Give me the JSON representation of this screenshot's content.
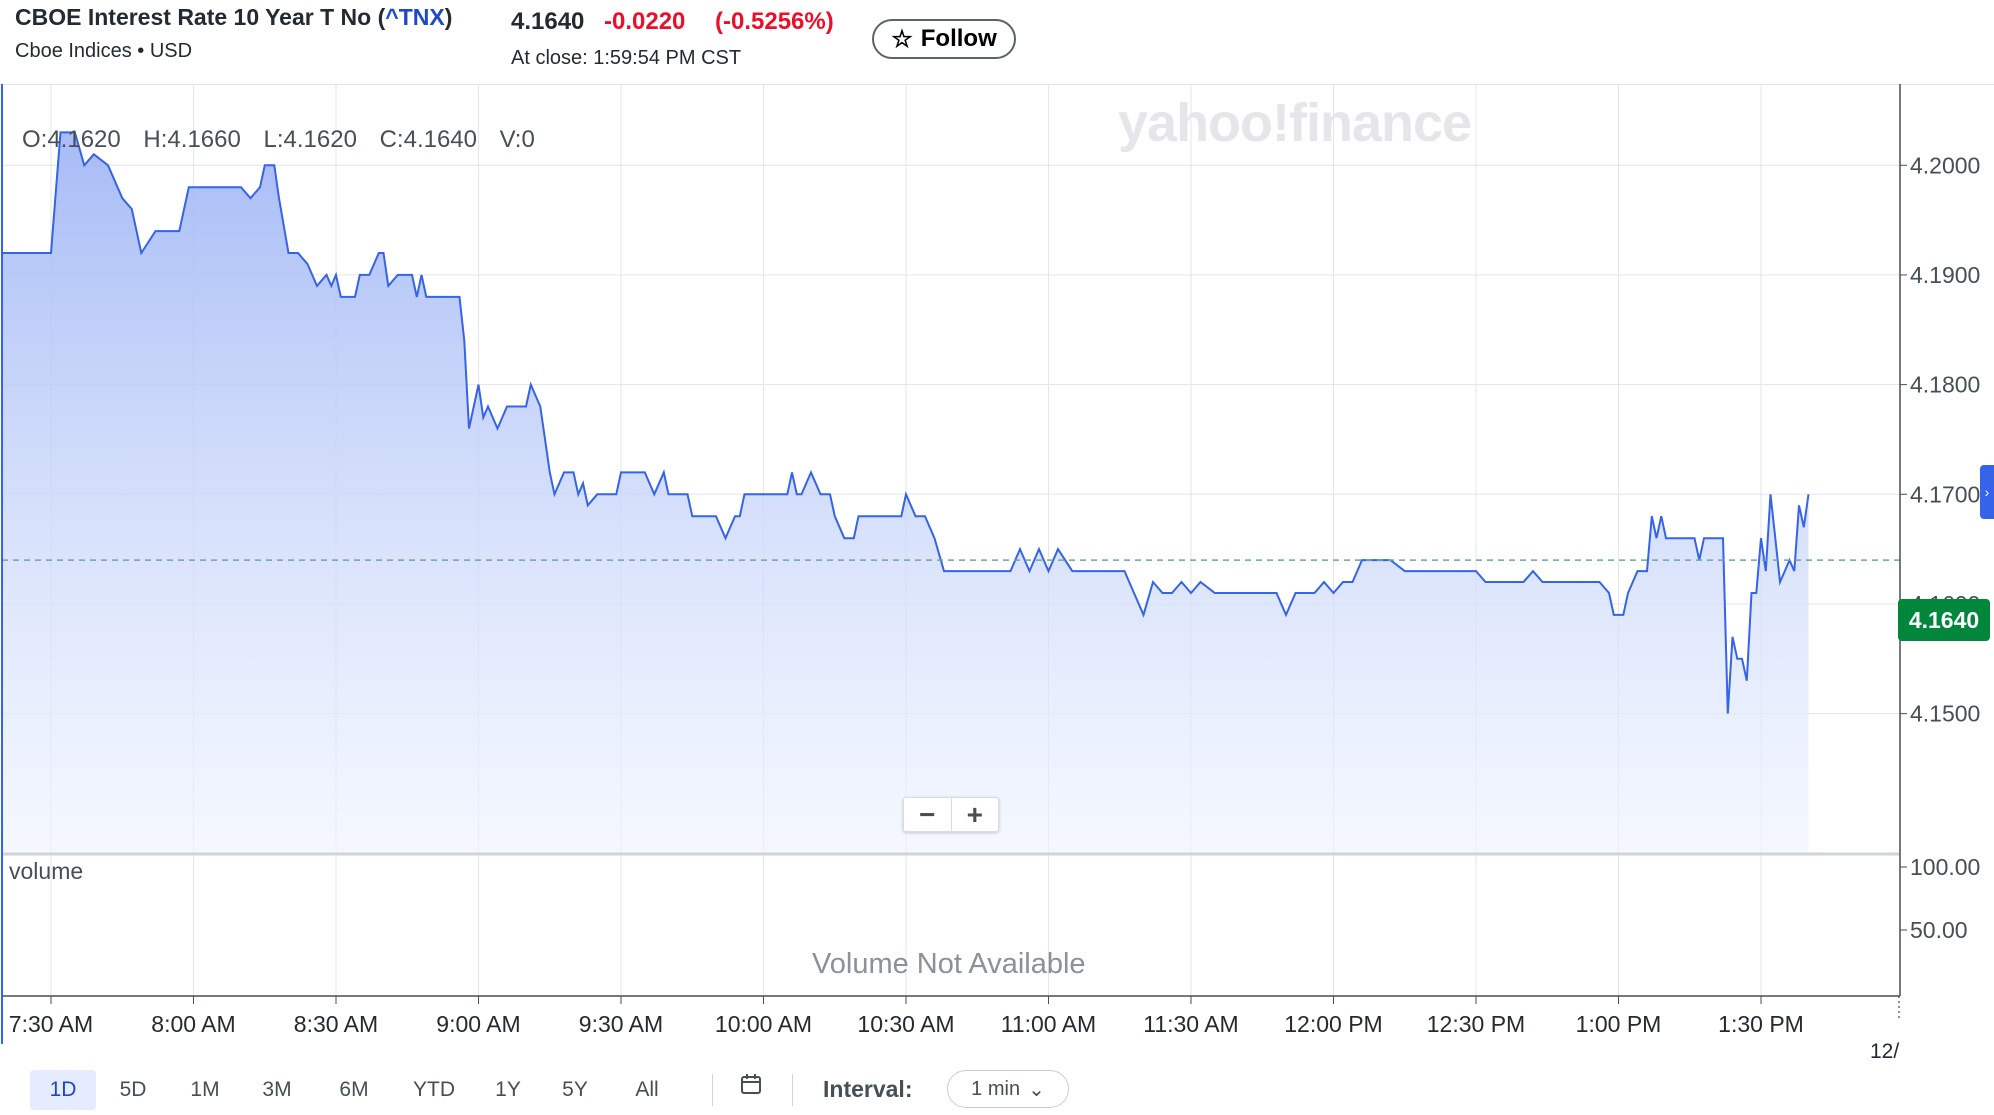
{
  "quote": {
    "name": "CBOE Interest Rate 10 Year T No",
    "symbol_open": "(",
    "symbol": "^TNX",
    "symbol_close": ")",
    "exchange": "Cboe Indices • USD",
    "price": "4.1640",
    "change": "-0.0220",
    "change_pct": "(-0.5256%)",
    "close_time": "At close: 1:59:54 PM CST",
    "follow_label": "Follow"
  },
  "ohlc": {
    "o": "O:4.1620",
    "h": "H:4.1660",
    "l": "L:4.1620",
    "c": "C:4.1640",
    "v": "V:0"
  },
  "watermark": "yahoo!finance",
  "volume": {
    "label": "volume",
    "not_available": "Volume Not Available",
    "ticks": [
      "100.00",
      "50.00"
    ]
  },
  "zoom": {
    "minus": "−",
    "plus": "+"
  },
  "current_price_badge": "4.1640",
  "date_tick": "12/",
  "ranges": [
    "1D",
    "5D",
    "1M",
    "3M",
    "6M",
    "YTD",
    "1Y",
    "5Y",
    "All"
  ],
  "active_range": "1D",
  "interval": {
    "label": "Interval:",
    "value": "1 min"
  },
  "colors": {
    "line": "#3563e9",
    "up": "#00873c",
    "down": "#eb0f29",
    "symbol": "#1d49c9"
  },
  "icons": {
    "follow": "star-outline-icon",
    "calendar": "calendar-icon",
    "dropdown": "chevron-down-icon",
    "side": "chevron-right-icon"
  },
  "chart_data": {
    "type": "area",
    "title": "",
    "xlabel": "",
    "ylabel": "",
    "x_ticks": [
      "7:30 AM",
      "8:00 AM",
      "8:30 AM",
      "9:00 AM",
      "9:30 AM",
      "10:00 AM",
      "10:30 AM",
      "11:00 AM",
      "11:30 AM",
      "12:00 PM",
      "12:30 PM",
      "1:00 PM",
      "1:30 PM"
    ],
    "y_ticks": [
      4.15,
      4.16,
      4.164,
      4.17,
      4.18,
      4.19,
      4.2
    ],
    "y_tick_labels": [
      "4.1500",
      "4.1600",
      "4.1700",
      "4.1800",
      "4.1900",
      "4.2000"
    ],
    "ylim": [
      4.1455,
      4.2075
    ],
    "xlim": [
      "7:30 AM",
      "2:00 PM"
    ],
    "reference_line": 4.164,
    "grid": true,
    "series": [
      {
        "x_minutes_from_7_00": [
          30,
          32,
          35,
          37,
          39,
          42,
          45,
          47,
          49,
          52,
          53,
          55,
          57,
          59,
          60,
          62,
          65,
          68,
          70,
          72,
          74,
          75,
          76,
          77,
          78,
          80,
          81,
          82,
          84,
          86,
          88,
          89,
          90,
          91,
          92,
          93,
          94,
          95,
          96,
          97,
          99,
          100,
          101,
          103,
          104,
          106,
          107,
          108,
          109,
          110,
          111,
          113,
          114,
          116,
          117,
          118,
          120,
          121,
          122,
          124,
          126,
          127,
          129,
          130,
          131,
          133,
          135,
          136,
          138,
          140,
          141,
          142,
          143,
          145,
          147,
          149,
          150,
          151,
          152,
          153,
          155,
          157,
          159,
          160,
          162,
          163,
          164,
          165,
          167,
          170,
          172,
          174,
          175,
          176,
          178,
          180,
          183,
          185,
          186,
          187,
          188,
          190,
          192,
          194,
          195,
          197,
          199,
          200,
          201,
          203,
          205,
          207,
          209,
          210,
          212,
          214,
          216,
          218,
          220,
          222,
          225,
          228,
          230,
          232,
          234,
          236,
          238,
          240,
          242,
          245,
          248,
          250,
          252,
          254,
          256,
          258,
          260,
          262,
          264,
          266,
          268,
          270,
          272,
          275,
          278,
          280,
          283,
          286,
          288,
          290,
          292,
          294,
          296,
          298,
          300,
          302,
          304,
          306,
          308,
          310,
          312,
          315,
          318,
          320,
          322,
          324,
          326,
          328,
          330,
          332,
          334,
          336,
          338,
          340,
          342,
          344,
          346,
          348,
          350,
          352,
          354,
          356,
          358,
          359,
          360,
          361,
          362,
          363,
          364,
          366,
          367,
          368,
          369,
          370,
          371,
          372,
          373,
          374,
          375,
          376,
          377,
          378,
          379,
          380,
          381,
          382,
          383,
          384,
          385,
          386,
          387,
          388,
          389,
          390,
          391,
          392,
          393,
          394,
          395,
          396,
          397,
          398,
          399,
          400
        ],
        "values": [
          4.192,
          4.203,
          4.203,
          4.2,
          4.201,
          4.2,
          4.197,
          4.196,
          4.192,
          4.194,
          4.194,
          4.194,
          4.194,
          4.198,
          4.198,
          4.198,
          4.198,
          4.198,
          4.198,
          4.197,
          4.198,
          4.2,
          4.2,
          4.2,
          4.197,
          4.192,
          4.192,
          4.192,
          4.191,
          4.189,
          4.19,
          4.189,
          4.19,
          4.188,
          4.188,
          4.188,
          4.188,
          4.19,
          4.19,
          4.19,
          4.192,
          4.192,
          4.189,
          4.19,
          4.19,
          4.19,
          4.188,
          4.19,
          4.188,
          4.188,
          4.188,
          4.188,
          4.188,
          4.188,
          4.184,
          4.176,
          4.18,
          4.177,
          4.178,
          4.176,
          4.178,
          4.178,
          4.178,
          4.178,
          4.18,
          4.178,
          4.172,
          4.17,
          4.172,
          4.172,
          4.17,
          4.171,
          4.169,
          4.17,
          4.17,
          4.17,
          4.172,
          4.172,
          4.172,
          4.172,
          4.172,
          4.17,
          4.172,
          4.17,
          4.17,
          4.17,
          4.17,
          4.168,
          4.168,
          4.168,
          4.166,
          4.168,
          4.168,
          4.17,
          4.17,
          4.17,
          4.17,
          4.17,
          4.172,
          4.17,
          4.17,
          4.172,
          4.17,
          4.17,
          4.168,
          4.166,
          4.166,
          4.168,
          4.168,
          4.168,
          4.168,
          4.168,
          4.168,
          4.17,
          4.168,
          4.168,
          4.166,
          4.163,
          4.163,
          4.163,
          4.163,
          4.163,
          4.163,
          4.163,
          4.165,
          4.163,
          4.165,
          4.163,
          4.165,
          4.163,
          4.163,
          4.163,
          4.163,
          4.163,
          4.163,
          4.161,
          4.159,
          4.162,
          4.161,
          4.161,
          4.162,
          4.161,
          4.162,
          4.161,
          4.161,
          4.161,
          4.161,
          4.161,
          4.161,
          4.159,
          4.161,
          4.161,
          4.161,
          4.162,
          4.161,
          4.162,
          4.162,
          4.164,
          4.164,
          4.164,
          4.164,
          4.163,
          4.163,
          4.163,
          4.163,
          4.163,
          4.163,
          4.163,
          4.163,
          4.162,
          4.162,
          4.162,
          4.162,
          4.162,
          4.163,
          4.162,
          4.162,
          4.162,
          4.162,
          4.162,
          4.162,
          4.162,
          4.161,
          4.159,
          4.159,
          4.159,
          4.161,
          4.162,
          4.163,
          4.163,
          4.168,
          4.166,
          4.168,
          4.166,
          4.166,
          4.166,
          4.166,
          4.166,
          4.166,
          4.166,
          4.164,
          4.166,
          4.166,
          4.166,
          4.166,
          4.166,
          4.15,
          4.157,
          4.155,
          4.155,
          4.153,
          4.161,
          4.161,
          4.166,
          4.163,
          4.17,
          4.166,
          4.162,
          4.163,
          4.164,
          4.163,
          4.169,
          4.167,
          4.17,
          4.168,
          4.175,
          4.171
        ]
      }
    ]
  }
}
